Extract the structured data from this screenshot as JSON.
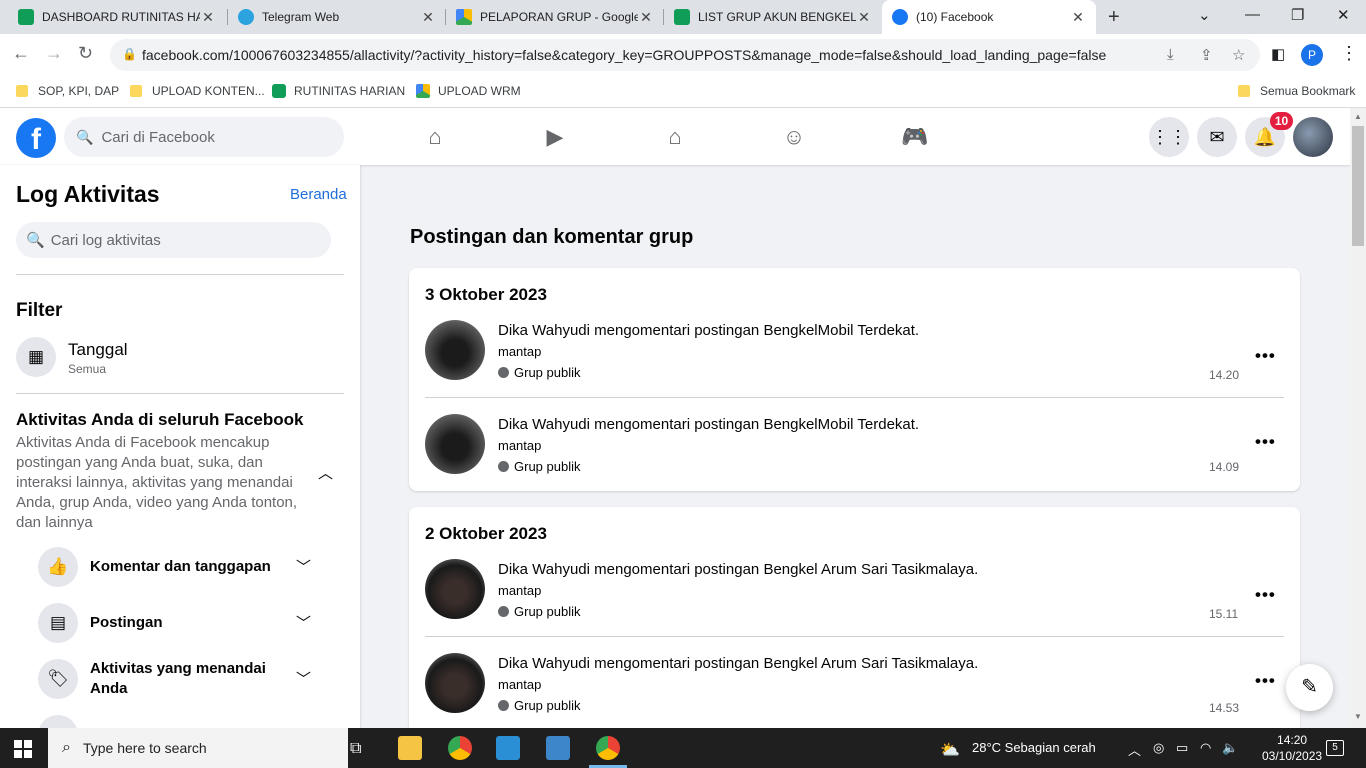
{
  "browser": {
    "tabs": [
      {
        "title": "DASHBOARD RUTINITAS HA",
        "icon": "sheets-icon",
        "active": false
      },
      {
        "title": "Telegram Web",
        "icon": "telegram-icon",
        "active": false
      },
      {
        "title": "PELAPORAN GRUP - Google",
        "icon": "drive-icon",
        "active": false
      },
      {
        "title": "LIST GRUP AKUN BENGKEL I",
        "icon": "sheets-icon",
        "active": false
      },
      {
        "title": "(10) Facebook",
        "icon": "facebook-icon",
        "active": true
      }
    ],
    "new_tab": "+",
    "url": "facebook.com/100067603234855/allactivity/?activity_history=false&category_key=GROUPPOSTS&manage_mode=false&should_load_landing_page=false",
    "profile_initial": "P",
    "bookmarks": [
      {
        "label": "SOP, KPI, DAP",
        "icon": "folder-icon"
      },
      {
        "label": "UPLOAD KONTEN...",
        "icon": "folder-icon"
      },
      {
        "label": "RUTINITAS HARIAN",
        "icon": "sheets-icon"
      },
      {
        "label": "UPLOAD WRM",
        "icon": "drive-icon"
      }
    ],
    "all_bookmarks": "Semua Bookmark"
  },
  "fb": {
    "search_placeholder": "Cari di Facebook",
    "notif_count": "10"
  },
  "sidebar": {
    "title": "Log Aktivitas",
    "home_link": "Beranda",
    "search_placeholder": "Cari log aktivitas",
    "filter_heading": "Filter",
    "date_filter_label": "Tanggal",
    "date_filter_value": "Semua",
    "section_title": "Aktivitas Anda di seluruh Facebook",
    "section_desc": "Aktivitas Anda di Facebook mencakup postingan yang Anda buat, suka, dan interaksi lainnya, aktivitas yang menandai Anda, grup Anda, video yang Anda tonton, dan lainnya",
    "menu": [
      {
        "label": "Komentar dan tanggapan",
        "icon": "thumbs-up-icon"
      },
      {
        "label": "Postingan",
        "icon": "post-icon"
      },
      {
        "label": "Aktivitas yang menandai Anda",
        "icon": "tag-icon"
      }
    ]
  },
  "main": {
    "title": "Postingan dan komentar grup",
    "groups": [
      {
        "date": "3 Oktober 2023",
        "entries": [
          {
            "user": "Dika Wahyudi",
            "verb": "mengomentari postingan",
            "target": "BengkelMobil Terdekat",
            "comment": "mantap",
            "privacy": "Grup publik",
            "time": "14.20"
          },
          {
            "user": "Dika Wahyudi",
            "verb": "mengomentari postingan",
            "target": "BengkelMobil Terdekat",
            "comment": "mantap",
            "privacy": "Grup publik",
            "time": "14.09"
          }
        ]
      },
      {
        "date": "2 Oktober 2023",
        "entries": [
          {
            "user": "Dika Wahyudi",
            "verb": "mengomentari postingan",
            "target": "Bengkel Arum Sari Tasikmalaya",
            "comment": "mantap",
            "privacy": "Grup publik",
            "time": "15.11"
          },
          {
            "user": "Dika Wahyudi",
            "verb": "mengomentari postingan",
            "target": "Bengkel Arum Sari Tasikmalaya",
            "comment": "mantap",
            "privacy": "Grup publik",
            "time": "14.53"
          }
        ]
      }
    ]
  },
  "taskbar": {
    "search_placeholder": "Type here to search",
    "weather": "28°C  Sebagian cerah",
    "time": "14:20",
    "date": "03/10/2023",
    "notifications": "5"
  }
}
